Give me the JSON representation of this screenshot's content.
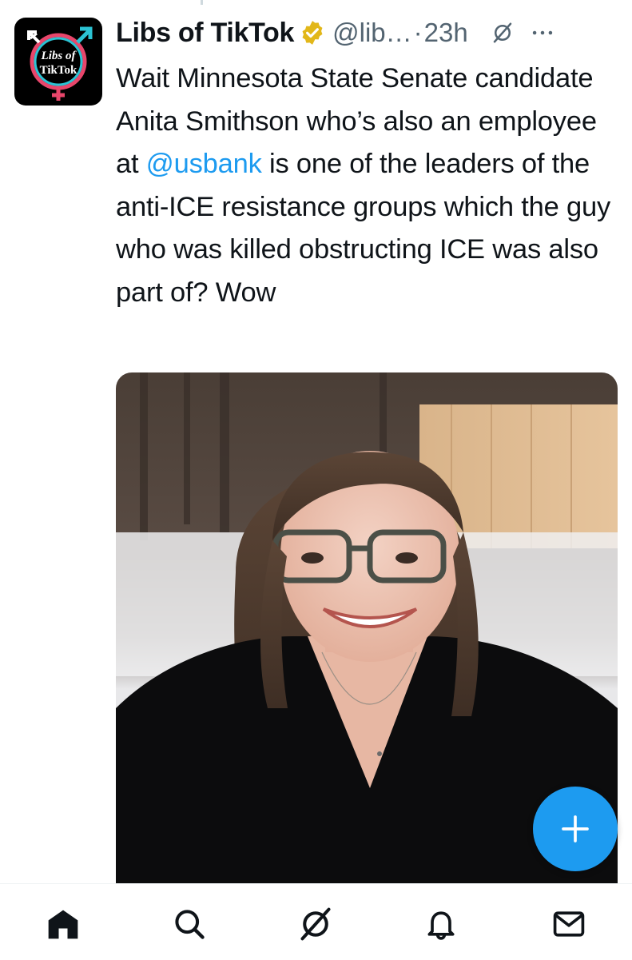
{
  "account": {
    "display_name": "Libs of TikTok",
    "handle": "@lib…",
    "separator": "·",
    "time": "23h",
    "avatar_text_line1": "Libs of",
    "avatar_text_line2": "TikTok"
  },
  "tweet": {
    "text_before_mention": "Wait Minnesota State Senate candidate Anita Smithson who’s also an employee at ",
    "mention": "@usbank",
    "text_after_mention": " is one of the leaders of the anti-ICE resistance groups which the guy who was killed obstructing ICE was also part of? Wow"
  },
  "media": {
    "description_icon": "photo-of-woman-with-glasses"
  },
  "colors": {
    "accent": "#1d9bf0",
    "verified_gold": "#e2b719",
    "secondary_text": "#536471"
  },
  "icons": {
    "verified": "verified-badge-icon",
    "grok": "grok-icon",
    "more": "more-options-icon",
    "compose": "plus-icon",
    "nav": [
      "home-icon",
      "search-icon",
      "grok-icon",
      "notifications-icon",
      "messages-icon"
    ]
  }
}
